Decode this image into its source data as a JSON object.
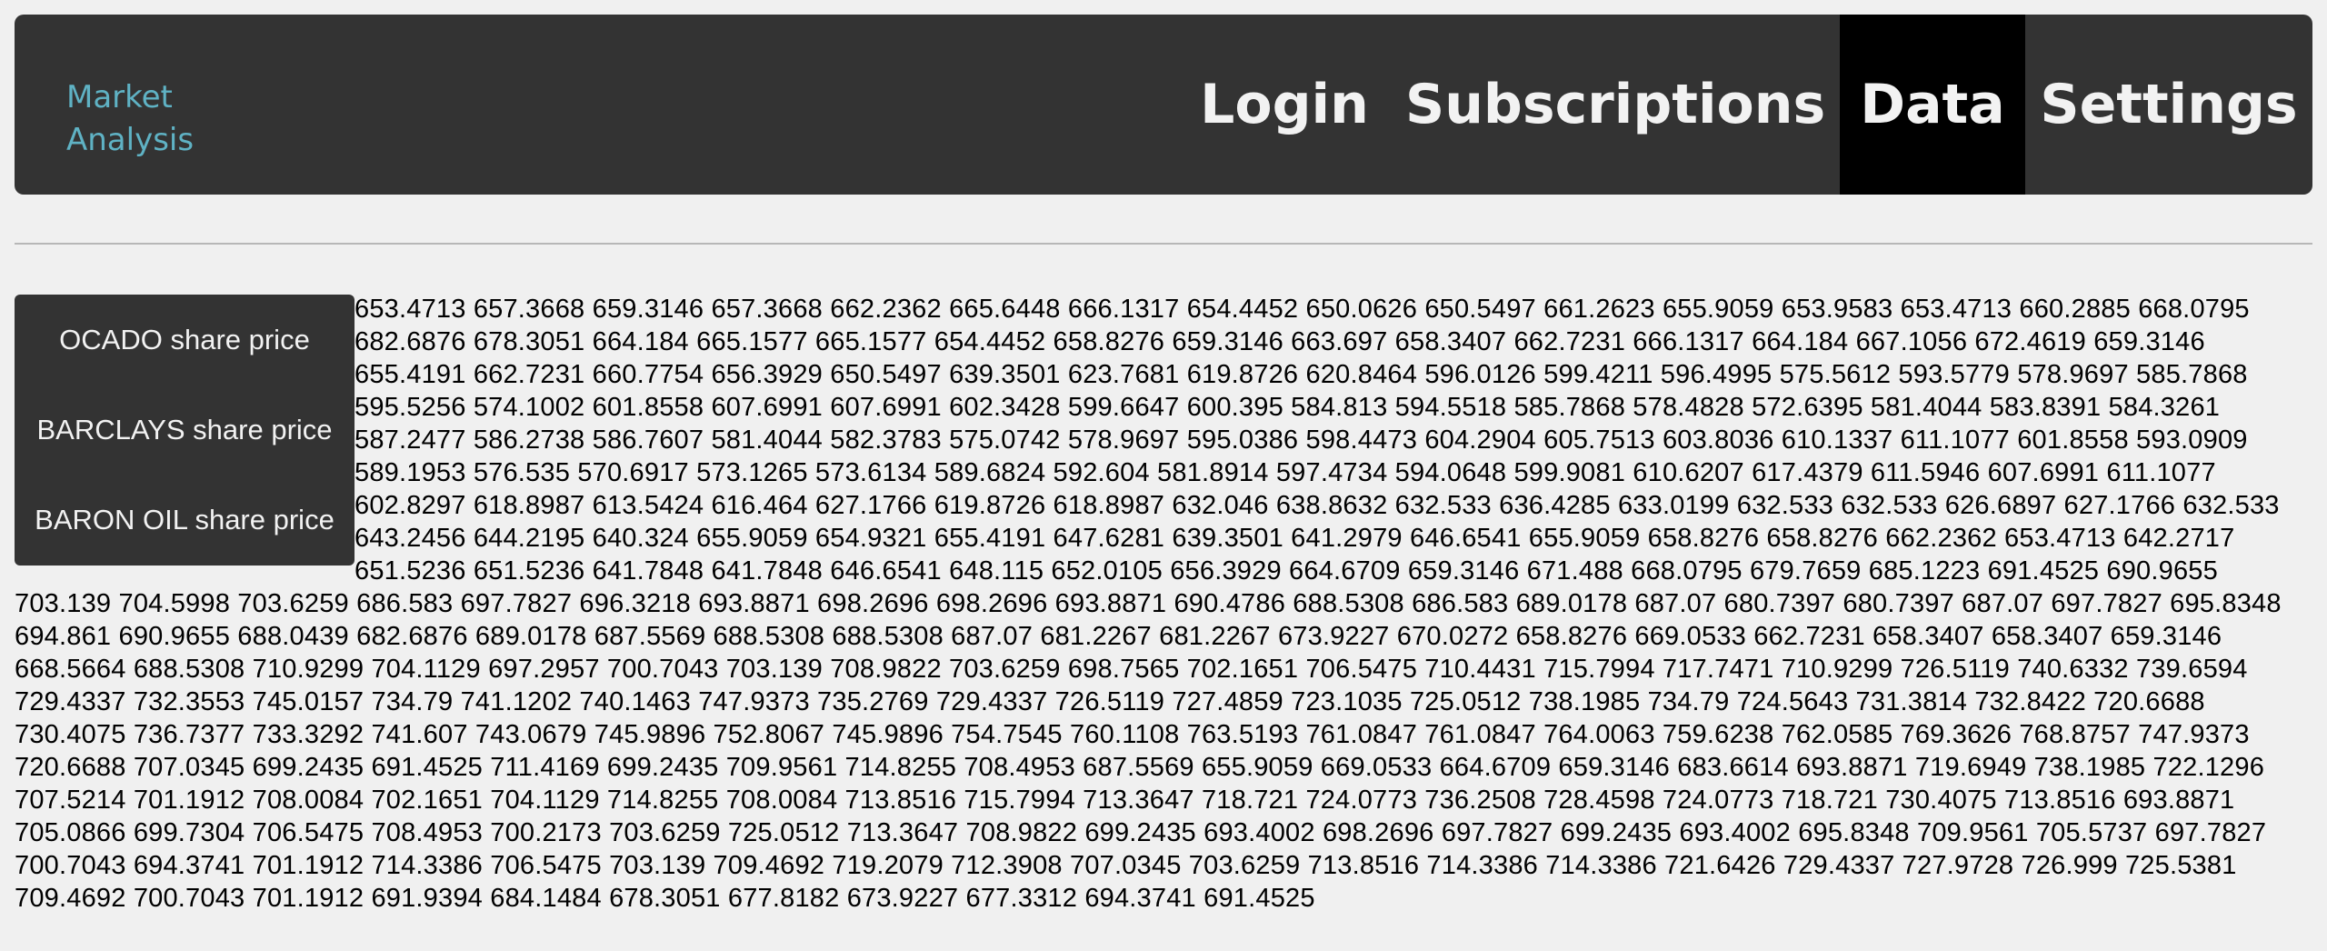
{
  "header": {
    "brand_line1": "Market",
    "brand_line2": "Analysis",
    "nav": {
      "login": "Login",
      "subscriptions": "Subscriptions",
      "data": "Data",
      "settings": "Settings"
    },
    "active": "Data"
  },
  "sidebar": {
    "items": [
      {
        "label": "OCADO share price"
      },
      {
        "label": "BARCLAYS share price"
      },
      {
        "label": "BARON OIL share price"
      }
    ]
  },
  "price_data": "653.4713 657.3668 659.3146 657.3668 662.2362 665.6448 666.1317 654.4452 650.0626 650.5497 661.2623 655.9059 653.9583 653.4713 660.2885 668.0795 682.6876 678.3051 664.184 665.1577 665.1577 654.4452 658.8276 659.3146 663.697 658.3407 662.7231 666.1317 664.184 667.1056 672.4619 659.3146 655.4191 662.7231 660.7754 656.3929 650.5497 639.3501 623.7681 619.8726 620.8464 596.0126 599.4211 596.4995 575.5612 593.5779 578.9697 585.7868 595.5256 574.1002 601.8558 607.6991 607.6991 602.3428 599.6647 600.395 584.813 594.5518 585.7868 578.4828 572.6395 581.4044 583.8391 584.3261 587.2477 586.2738 586.7607 581.4044 582.3783 575.0742 578.9697 595.0386 598.4473 604.2904 605.7513 603.8036 610.1337 611.1077 601.8558 593.0909 589.1953 576.535 570.6917 573.1265 573.6134 589.6824 592.604 581.8914 597.4734 594.0648 599.9081 610.6207 617.4379 611.5946 607.6991 611.1077 602.8297 618.8987 613.5424 616.464 627.1766 619.8726 618.8987 632.046 638.8632 632.533 636.4285 633.0199 632.533 632.533 626.6897 627.1766 632.533 643.2456 644.2195 640.324 655.9059 654.9321 655.4191 647.6281 639.3501 641.2979 646.6541 655.9059 658.8276 658.8276 662.2362 653.4713 642.2717 651.5236 651.5236 641.7848 641.7848 646.6541 648.115 652.0105 656.3929 664.6709 659.3146 671.488 668.0795 679.7659 685.1223 691.4525 690.9655 703.139 704.5998 703.6259 686.583 697.7827 696.3218 693.8871 698.2696 698.2696 693.8871 690.4786 688.5308 686.583 689.0178 687.07 680.7397 680.7397 687.07 697.7827 695.8348 694.861 690.9655 688.0439 682.6876 689.0178 687.5569 688.5308 688.5308 687.07 681.2267 681.2267 673.9227 670.0272 658.8276 669.0533 662.7231 658.3407 658.3407 659.3146 668.5664 688.5308 710.9299 704.1129 697.2957 700.7043 703.139 708.9822 703.6259 698.7565 702.1651 706.5475 710.4431 715.7994 717.7471 710.9299 726.5119 740.6332 739.6594 729.4337 732.3553 745.0157 734.79 741.1202 740.1463 747.9373 735.2769 729.4337 726.5119 727.4859 723.1035 725.0512 738.1985 734.79 724.5643 731.3814 732.8422 720.6688 730.4075 736.7377 733.3292 741.607 743.0679 745.9896 752.8067 745.9896 754.7545 760.1108 763.5193 761.0847 761.0847 764.0063 759.6238 762.0585 769.3626 768.8757 747.9373 720.6688 707.0345 699.2435 691.4525 711.4169 699.2435 709.9561 714.8255 708.4953 687.5569 655.9059 669.0533 664.6709 659.3146 683.6614 693.8871 719.6949 738.1985 722.1296 707.5214 701.1912 708.0084 702.1651 704.1129 714.8255 708.0084 713.8516 715.7994 713.3647 718.721 724.0773 736.2508 728.4598 724.0773 718.721 730.4075 713.8516 693.8871 705.0866 699.7304 706.5475 708.4953 700.2173 703.6259 725.0512 713.3647 708.9822 699.2435 693.4002 698.2696 697.7827 699.2435 693.4002 695.8348 709.9561 705.5737 697.7827 700.7043 694.3741 701.1912 714.3386 706.5475 703.139 709.4692 719.2079 712.3908 707.0345 703.6259 713.8516 714.3386 714.3386 721.6426 729.4337 727.9728 726.999 725.5381 709.4692 700.7043 701.1912 691.9394 684.1484 678.3051 677.8182 673.9227 677.3312 694.3741 691.4525"
}
